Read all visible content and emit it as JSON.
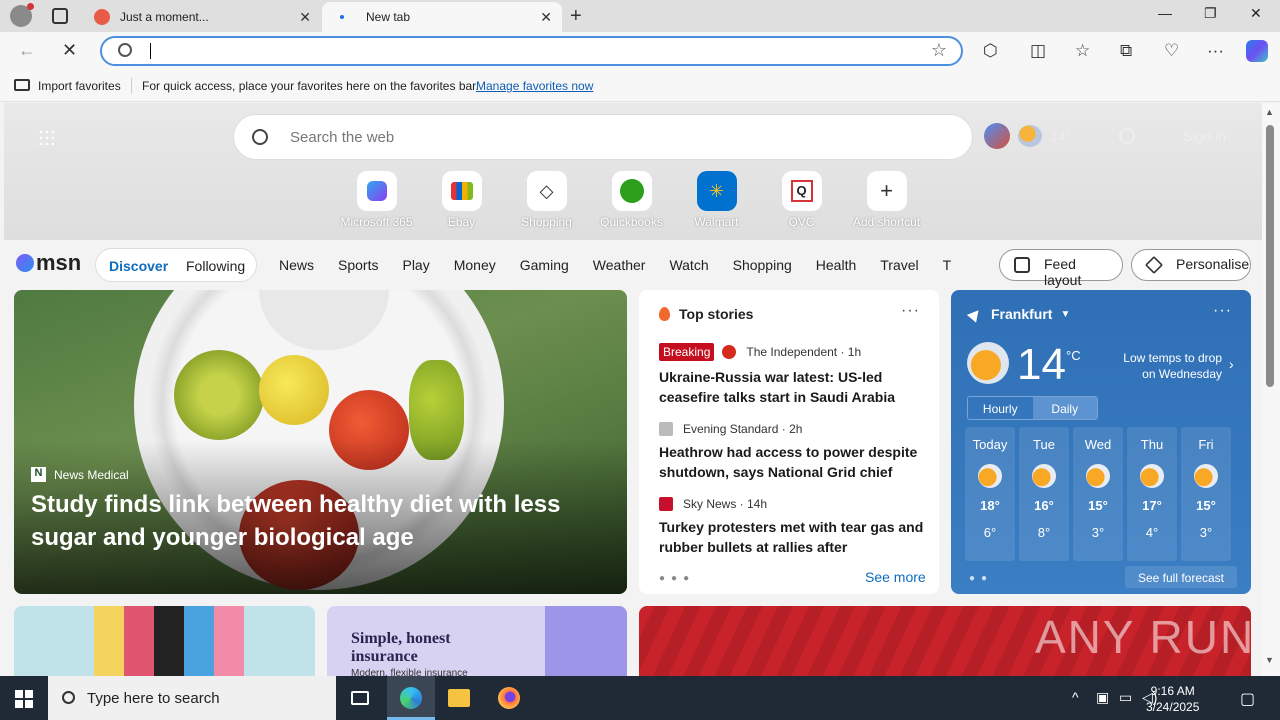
{
  "browser": {
    "tabs": [
      {
        "title": "Just a moment...",
        "active": false
      },
      {
        "title": "New tab",
        "active": true
      }
    ],
    "address": {
      "value": "",
      "placeholder": ""
    },
    "favorites_bar": {
      "import_label": "Import favorites",
      "message": "For quick access, place your favorites here on the favorites bar.",
      "manage_link": "Manage favorites now"
    }
  },
  "newtab": {
    "search_placeholder": "Search the web",
    "weather_temp_short": "14°",
    "signin": "Sign in",
    "shortcuts": [
      {
        "label": "Microsoft 365",
        "icon": "m365-icon"
      },
      {
        "label": "Ebay",
        "icon": "ebay-icon"
      },
      {
        "label": "Shopping",
        "icon": "shopping-tag-icon"
      },
      {
        "label": "Quickbooks",
        "icon": "quickbooks-icon"
      },
      {
        "label": "Walmart",
        "icon": "walmart-icon"
      },
      {
        "label": "QVC",
        "icon": "qvc-icon"
      },
      {
        "label": "Add shortcut",
        "icon": "plus-icon"
      }
    ]
  },
  "msn": {
    "logo": "msn",
    "discover": "Discover",
    "following": "Following",
    "categories": [
      "News",
      "Sports",
      "Play",
      "Money",
      "Gaming",
      "Weather",
      "Watch",
      "Shopping",
      "Health",
      "Travel",
      "Tra"
    ],
    "feed_layout": "Feed layout",
    "personalise": "Personalise"
  },
  "feature": {
    "source": "News Medical",
    "source_initial": "N",
    "title": "Study finds link between healthy diet with less sugar and younger biological age"
  },
  "top_stories": {
    "header": "Top stories",
    "items": [
      {
        "badge": "Breaking",
        "source": "The Independent · 1h",
        "title": "Ukraine-Russia war latest: US-led ceasefire talks start in Saudi Arabia afte..."
      },
      {
        "badge": "",
        "source": "Evening Standard · 2h",
        "title": "Heathrow had access to power despite shutdown, says National Grid chief"
      },
      {
        "badge": "",
        "source": "Sky News · 14h",
        "title": "Turkey protesters met with tear gas and rubber bullets at rallies after president's..."
      }
    ],
    "see_more": "See more"
  },
  "weather": {
    "location": "Frankfurt",
    "temp": "14",
    "unit": "°C",
    "alert": "Low temps to drop on Wednesday",
    "tab_hourly": "Hourly",
    "tab_daily": "Daily",
    "days": [
      {
        "name": "Today",
        "hi": "18°",
        "lo": "6°"
      },
      {
        "name": "Tue",
        "hi": "16°",
        "lo": "8°"
      },
      {
        "name": "Wed",
        "hi": "15°",
        "lo": "3°"
      },
      {
        "name": "Thu",
        "hi": "17°",
        "lo": "4°"
      },
      {
        "name": "Fri",
        "hi": "15°",
        "lo": "3°"
      }
    ],
    "see_full": "See full forecast"
  },
  "ad": {
    "title": "Simple, honest insurance",
    "sub": "Modern, flexible insurance"
  },
  "watermark": "ANY RUN",
  "taskbar": {
    "search_placeholder": "Type here to search",
    "time": "9:16 AM",
    "date": "3/24/2025"
  },
  "colors": {
    "accent": "#0f6cbd",
    "weather_bg": "#2f6fb5",
    "breaking": "#c50f1f",
    "taskbar": "#1f2a36"
  }
}
